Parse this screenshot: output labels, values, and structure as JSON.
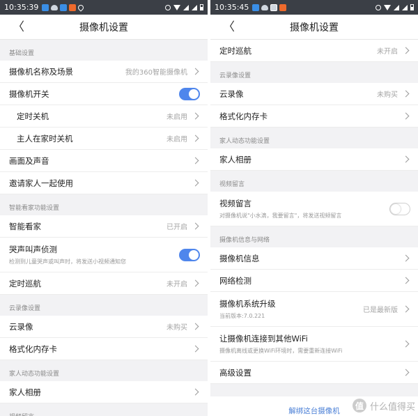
{
  "left": {
    "status_time": "10:35:39",
    "title": "摄像机设置",
    "sec_basic": "基础设置",
    "camera_name_label": "摄像机名称及场景",
    "camera_name_value": "我的360智能摄像机",
    "camera_switch_label": "摄像机开关",
    "timed_off_label": "定时关机",
    "timed_off_value": "未启用",
    "home_off_label": "主人在家时关机",
    "home_off_value": "未启用",
    "picture_sound_label": "画面及声音",
    "invite_label": "邀请家人一起使用",
    "sec_smart": "智能看家功能设置",
    "smart_watch_label": "智能看家",
    "smart_watch_value": "已开启",
    "cry_detect_label": "哭声叫声侦测",
    "cry_detect_desc": "检测到儿童哭声或叫声时，将发送小视频通知您",
    "patrol_label": "定时巡航",
    "patrol_value": "未开启",
    "sec_cloud": "云录像设置",
    "cloud_label": "云录像",
    "cloud_value": "未购买",
    "format_label": "格式化内存卡",
    "sec_family": "家人动态功能设置",
    "album_label": "家人相册",
    "sec_video_msg": "视频留言"
  },
  "right": {
    "status_time": "10:35:45",
    "title": "摄像机设置",
    "patrol_label": "定时巡航",
    "patrol_value": "未开启",
    "sec_cloud": "云录像设置",
    "cloud_label": "云录像",
    "cloud_value": "未购买",
    "format_label": "格式化内存卡",
    "sec_family": "家人动态功能设置",
    "album_label": "家人相册",
    "sec_video_msg": "视频留言",
    "video_msg_label": "视频留言",
    "video_msg_desc": "对摄像机说\"小水滴，我要留言\"，将发送视频留言",
    "sec_info": "摄像机信息与网络",
    "info_label": "摄像机信息",
    "network_label": "网络检测",
    "upgrade_label": "摄像机系统升级",
    "upgrade_desc": "当前版本:7.0.221",
    "upgrade_value": "已是最新版",
    "wifi_label": "让摄像机连接到其他WiFi",
    "wifi_desc": "摄像机离线或更换WiFi环境时，需要重新连接WiFi",
    "advanced_label": "高级设置",
    "unbind_label": "解绑这台摄像机"
  },
  "watermark": {
    "badge": "值",
    "text": "什么值得买"
  },
  "colors": {
    "toggle_on": "#4f86ec",
    "link": "#4a7fd6",
    "status_bar": "#3b3f46"
  }
}
